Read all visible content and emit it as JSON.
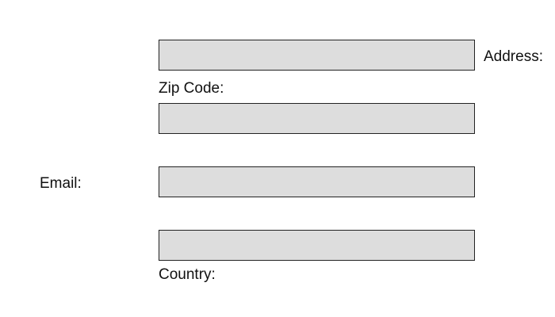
{
  "form": {
    "address": {
      "label": "Address:",
      "value": "",
      "placeholder": ""
    },
    "zip_code": {
      "label": "Zip Code:",
      "value": "",
      "placeholder": ""
    },
    "email": {
      "label": "Email:",
      "value": "",
      "placeholder": ""
    },
    "country": {
      "label": "Country:",
      "value": "",
      "placeholder": ""
    }
  },
  "colors": {
    "field_background": "#dddddd",
    "field_border": "#222222",
    "page_background": "#ffffff",
    "label_text": "#111111"
  }
}
